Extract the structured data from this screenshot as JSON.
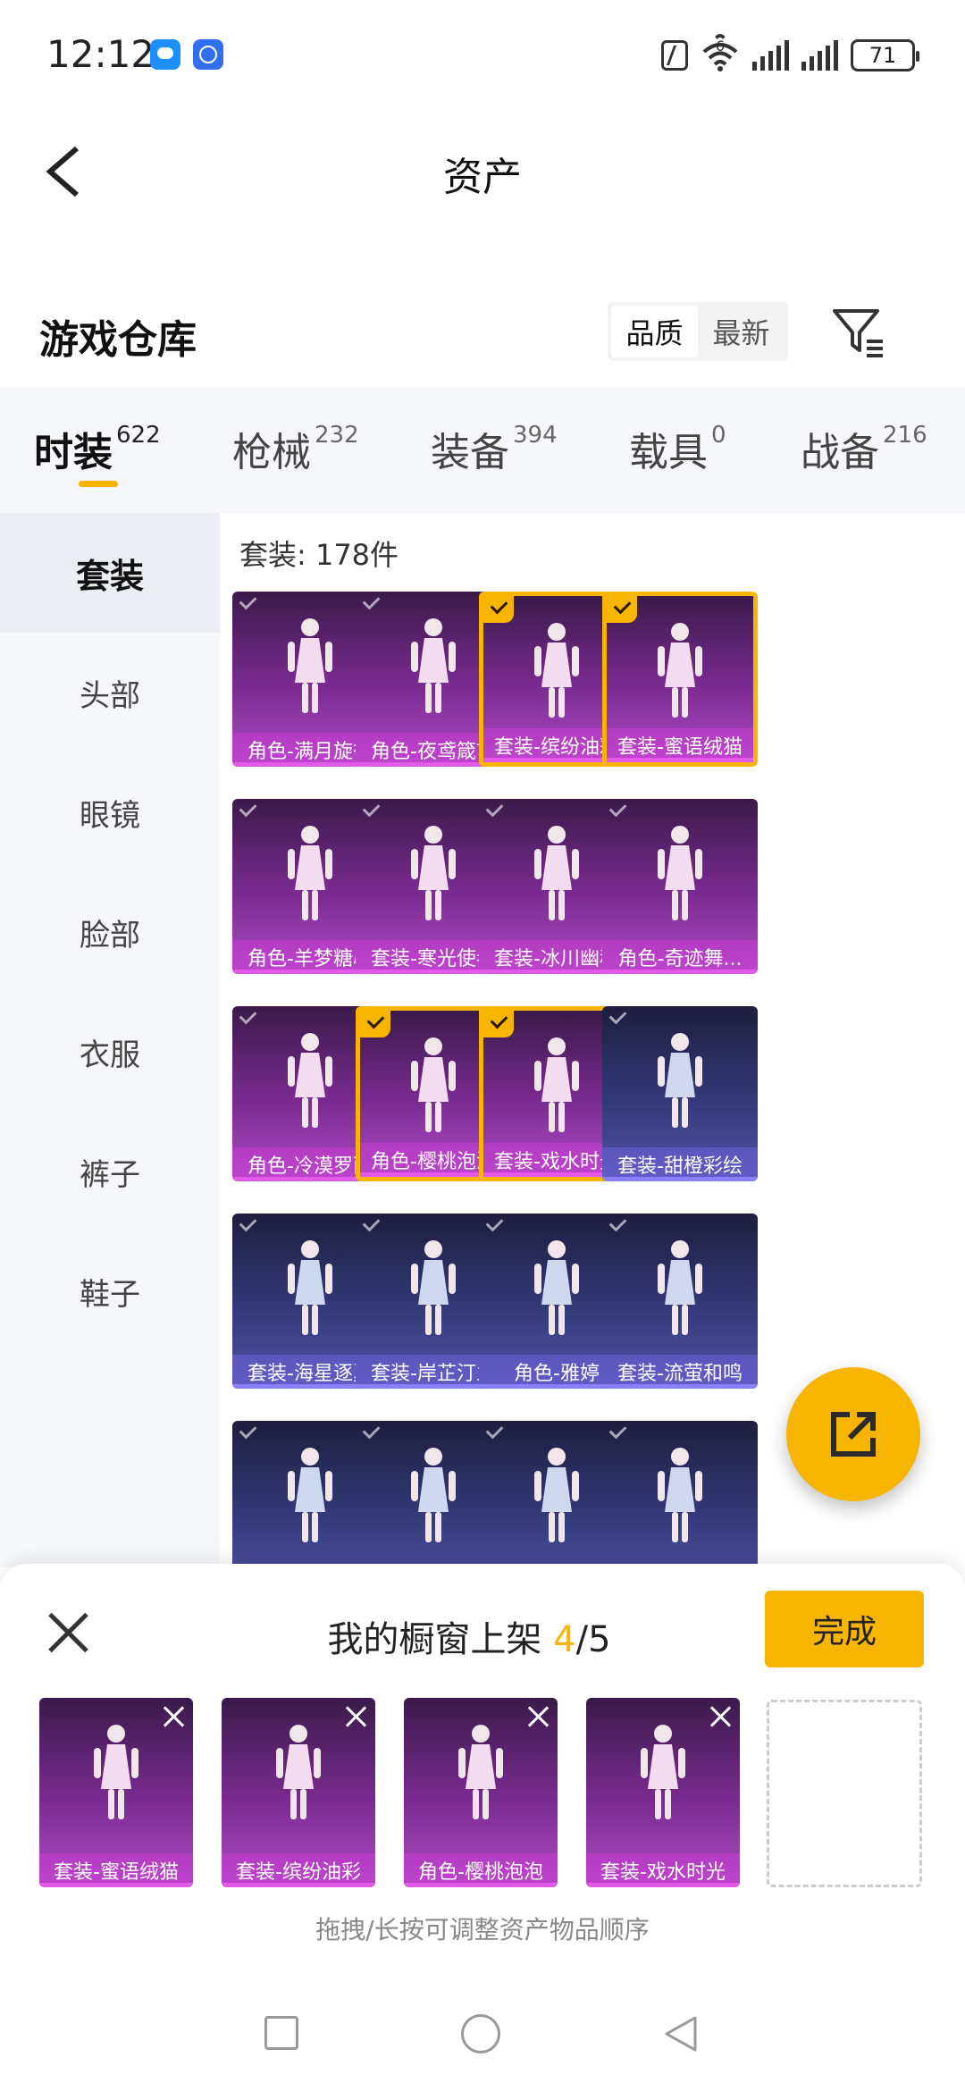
{
  "status_bar": {
    "time": "12:12",
    "battery": "71",
    "network_badge": "6"
  },
  "header": {
    "title": "资产"
  },
  "warehouse": {
    "title": "游戏仓库",
    "sort_options": [
      "品质",
      "最新"
    ]
  },
  "tabs": [
    {
      "label": "时装",
      "count": "622"
    },
    {
      "label": "枪械",
      "count": "232"
    },
    {
      "label": "装备",
      "count": "394"
    },
    {
      "label": "载具",
      "count": "0"
    },
    {
      "label": "战备",
      "count": "216"
    }
  ],
  "sidebar": {
    "items": [
      "套装",
      "头部",
      "眼镜",
      "脸部",
      "衣服",
      "裤子",
      "鞋子"
    ]
  },
  "grid": {
    "count_label": "套装: 178件",
    "items": [
      {
        "label": "角色-满月旋律",
        "tone": "purple",
        "selected": false
      },
      {
        "label": "角色-夜鸢箴言",
        "tone": "purple",
        "selected": false
      },
      {
        "label": "套装-缤纷油彩",
        "tone": "purple",
        "selected": true
      },
      {
        "label": "套装-蜜语绒猫",
        "tone": "purple",
        "selected": true
      },
      {
        "label": "角色-羊梦糖心",
        "tone": "purple",
        "selected": false
      },
      {
        "label": "套装-寒光使者",
        "tone": "purple",
        "selected": false
      },
      {
        "label": "套装-冰川幽秘",
        "tone": "purple",
        "selected": false
      },
      {
        "label": "角色-奇迹舞...",
        "tone": "purple",
        "selected": false
      },
      {
        "label": "角色-冷漠罗丽",
        "tone": "purple",
        "selected": false
      },
      {
        "label": "角色-樱桃泡泡",
        "tone": "purple",
        "selected": true
      },
      {
        "label": "套装-戏水时光",
        "tone": "purple",
        "selected": true
      },
      {
        "label": "套装-甜橙彩绘",
        "tone": "blue",
        "selected": false
      },
      {
        "label": "套装-海星逐夏",
        "tone": "blue",
        "selected": false
      },
      {
        "label": "套装-岸芷汀兰",
        "tone": "blue",
        "selected": false
      },
      {
        "label": "角色-雅婷",
        "tone": "blue",
        "selected": false
      },
      {
        "label": "套装-流萤和鸣",
        "tone": "blue",
        "selected": false
      },
      {
        "label": "",
        "tone": "blue",
        "selected": false
      },
      {
        "label": "",
        "tone": "blue",
        "selected": false
      },
      {
        "label": "",
        "tone": "blue",
        "selected": false
      },
      {
        "label": "",
        "tone": "blue",
        "selected": false
      }
    ]
  },
  "shelf": {
    "title_prefix": "我的橱窗上架 ",
    "current": "4",
    "total": "/5",
    "done_label": "完成",
    "hint": "拖拽/长按可调整资产物品顺序",
    "items": [
      "套装-蜜语绒猫",
      "套装-缤纷油彩",
      "角色-樱桃泡泡",
      "套装-戏水时光"
    ]
  },
  "colors": {
    "accent": "#f7b500",
    "purple_card": "#7b2b92",
    "blue_card": "#343a7a"
  }
}
